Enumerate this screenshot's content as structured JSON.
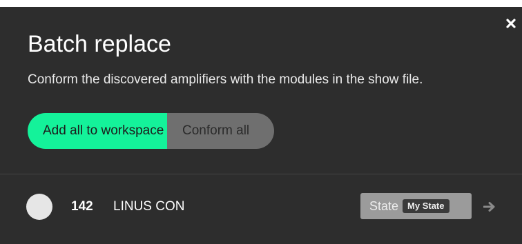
{
  "dialog": {
    "title": "Batch replace",
    "subtitle": "Conform the discovered amplifiers with the modules in the show file.",
    "close_icon": "close-icon"
  },
  "actions": {
    "primary_label": "Add all to workspace",
    "secondary_label": "Conform all"
  },
  "amplifiers": [
    {
      "id": "142",
      "name": "LINUS CON",
      "state_label": "State",
      "state_value": "My State",
      "arrow_icon": "arrow-right-icon"
    }
  ],
  "colors": {
    "background": "#2d2d2d",
    "accent": "#14f29a",
    "secondary_button": "#6f6f6f",
    "state_pill": "#9b9b9b"
  }
}
